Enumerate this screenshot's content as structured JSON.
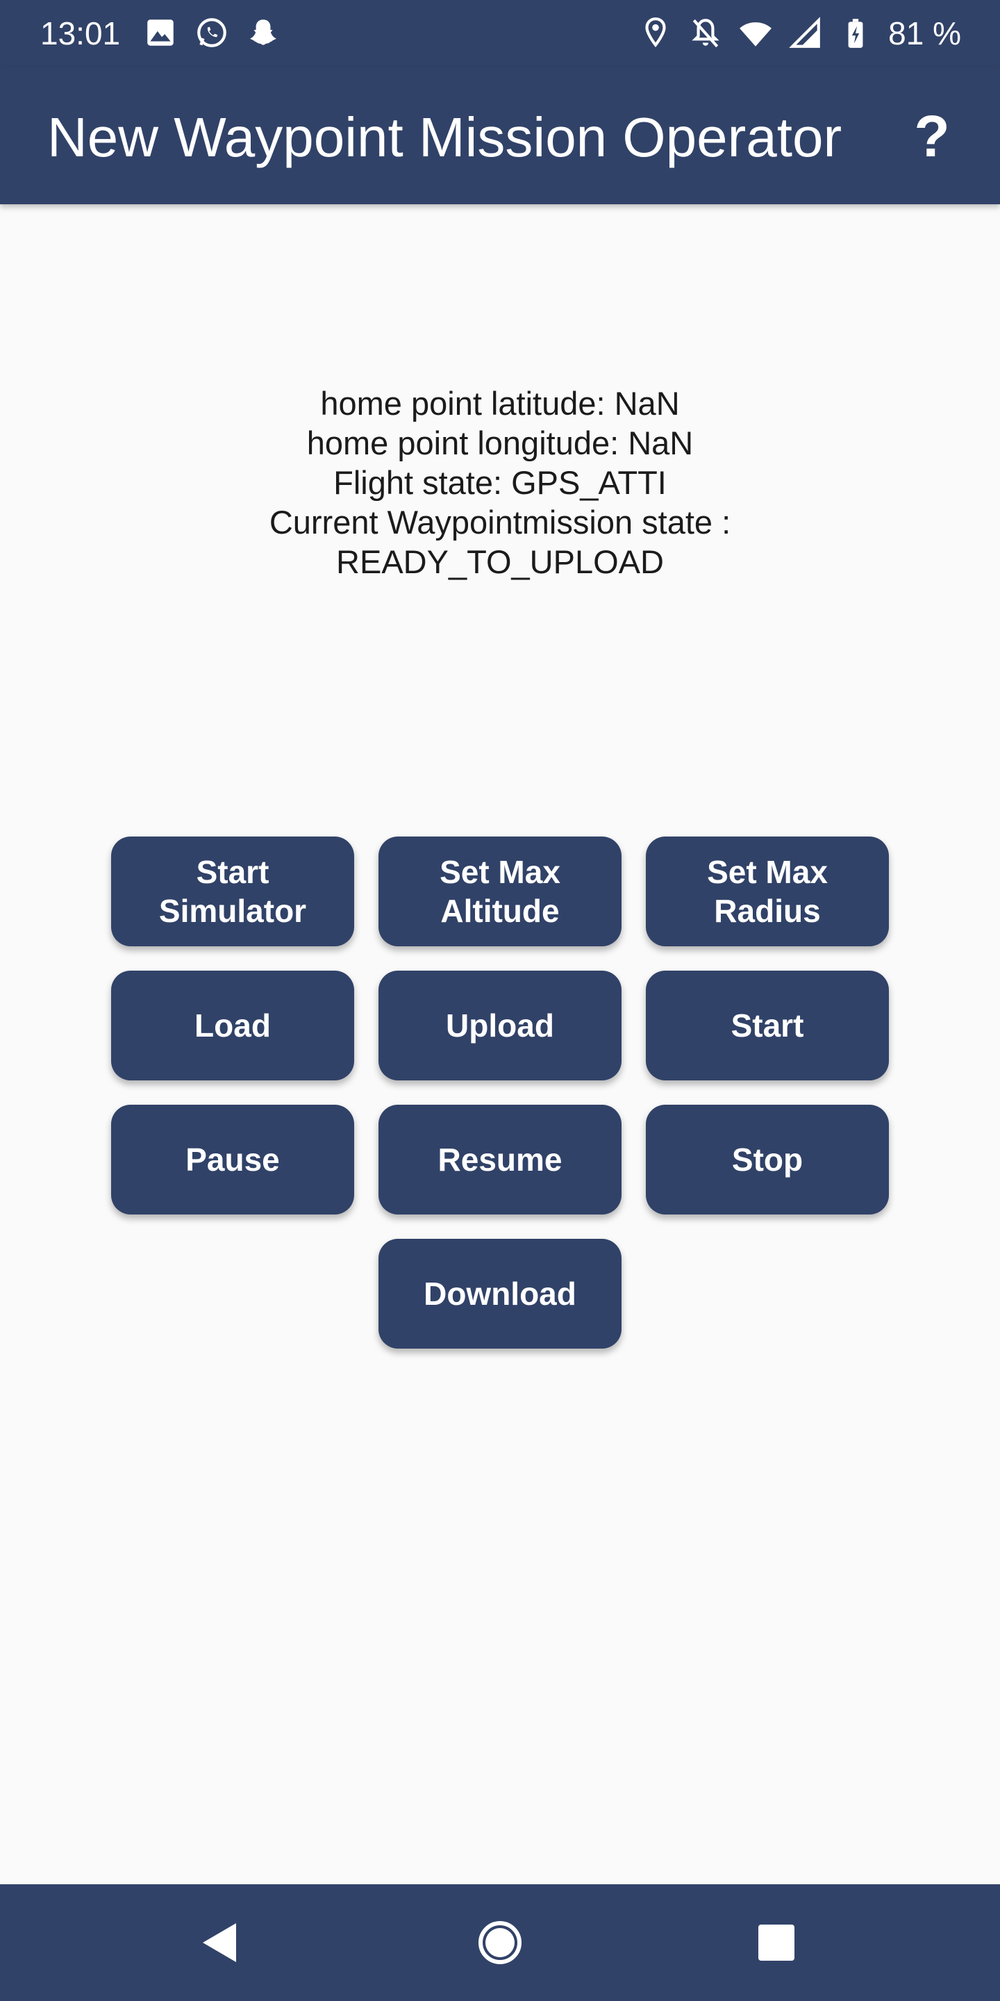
{
  "status_bar": {
    "time": "13:01",
    "left_icons": [
      "image-icon",
      "whatsapp-icon",
      "snapchat-icon"
    ],
    "right_icons": [
      "location-icon",
      "notifications-off-icon",
      "wifi-icon",
      "cellular-icon",
      "battery-charging-icon"
    ],
    "battery": "81 %"
  },
  "app_bar": {
    "title": "New Waypoint Mission Operator",
    "help_label": "?"
  },
  "info": {
    "home_latitude": "home point latitude: NaN",
    "home_longitude": "home point longitude: NaN",
    "flight_state": "Flight state: GPS_ATTI",
    "mission_state_label": "Current Waypointmission state :",
    "mission_state_value": "READY_TO_UPLOAD"
  },
  "buttons": {
    "start_simulator": "Start\nSimulator",
    "set_max_altitude": "Set Max\nAltitude",
    "set_max_radius": "Set Max\nRadius",
    "load": "Load",
    "upload": "Upload",
    "start": "Start",
    "pause": "Pause",
    "resume": "Resume",
    "stop": "Stop",
    "download": "Download"
  },
  "nav_bar": {
    "icons": [
      "back-icon",
      "home-icon",
      "recents-icon"
    ]
  },
  "colors": {
    "primary": "#314268",
    "background": "#fafafa",
    "text": "#1b1b1b",
    "on_primary": "#ffffff"
  }
}
